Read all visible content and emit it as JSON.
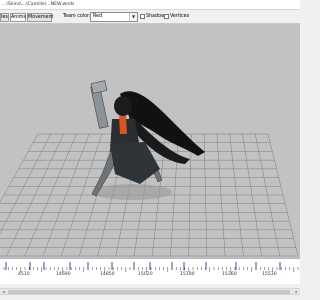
{
  "window": {
    "title": "...\\Skins\\...\\Camille\\...NEW.wnds"
  },
  "toolbar": {
    "tabs": [
      {
        "label": "les",
        "active": false
      },
      {
        "label": "Anims",
        "active": true
      },
      {
        "label": "Movement",
        "active": false
      }
    ],
    "team_color_label": "Team color:",
    "team_color_value": "Red",
    "shadows_label": "Shadows",
    "vertices_label": "Vertices"
  },
  "timeline": {
    "tick_labels": [
      "4510",
      "14690",
      "14850",
      "15020",
      "15190",
      "15360",
      "15530"
    ]
  },
  "scene": {
    "background": "#c2c2c2",
    "grid_color": "#7e7e7e",
    "accent_color": "#e0531c"
  }
}
